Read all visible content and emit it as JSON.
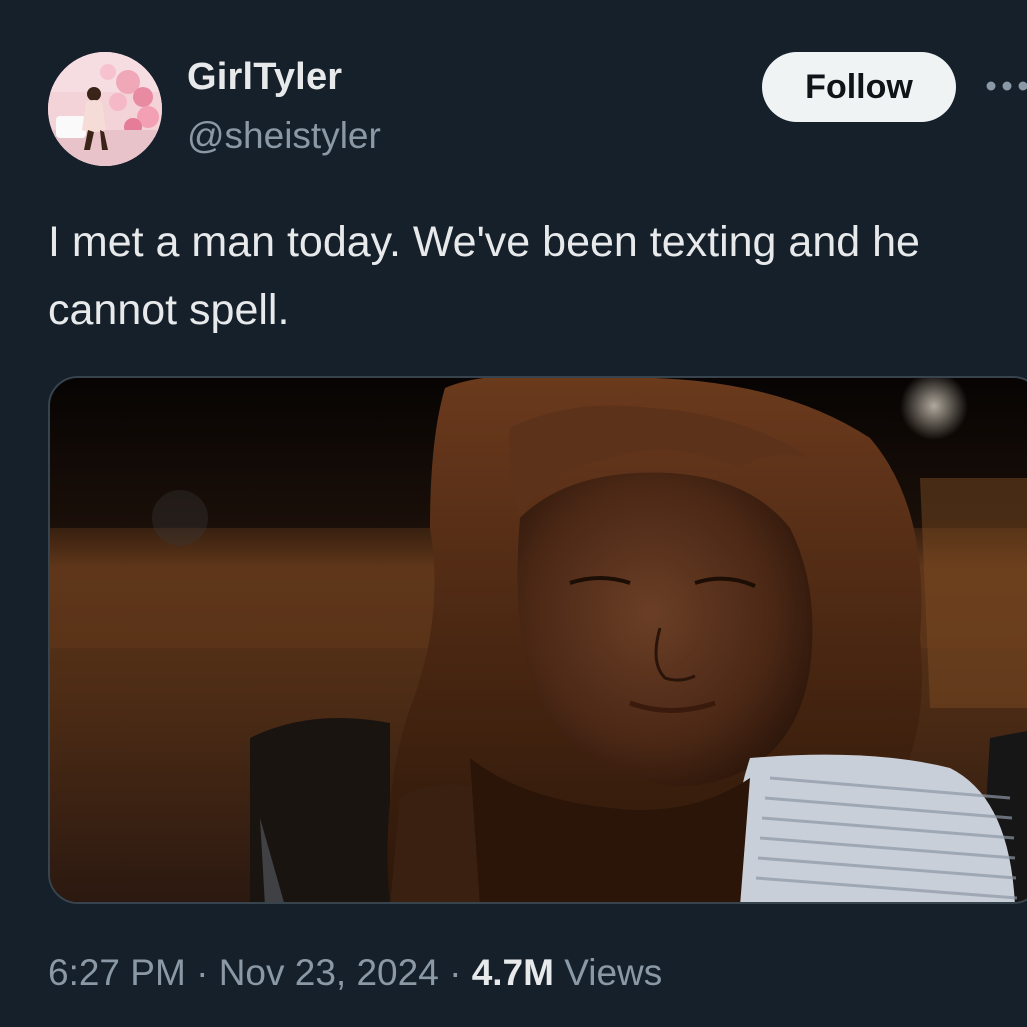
{
  "user": {
    "display_name": "GirlTyler",
    "handle": "@sheistyler"
  },
  "actions": {
    "follow_label": "Follow",
    "more_icon": "more-horizontal-icon"
  },
  "tweet": {
    "text": "I met a man today. We've been texting and he cannot spell."
  },
  "meta": {
    "time": "6:27 PM",
    "separator": " · ",
    "date": "Nov 23, 2024",
    "views_count": "4.7M",
    "views_label": " Views"
  },
  "colors": {
    "background": "#15202b",
    "primary_text": "#e7e9ea",
    "secondary_text": "#8b98a5",
    "follow_button_bg": "#eff3f4",
    "follow_button_text": "#0f1419",
    "media_border": "#38444d"
  }
}
